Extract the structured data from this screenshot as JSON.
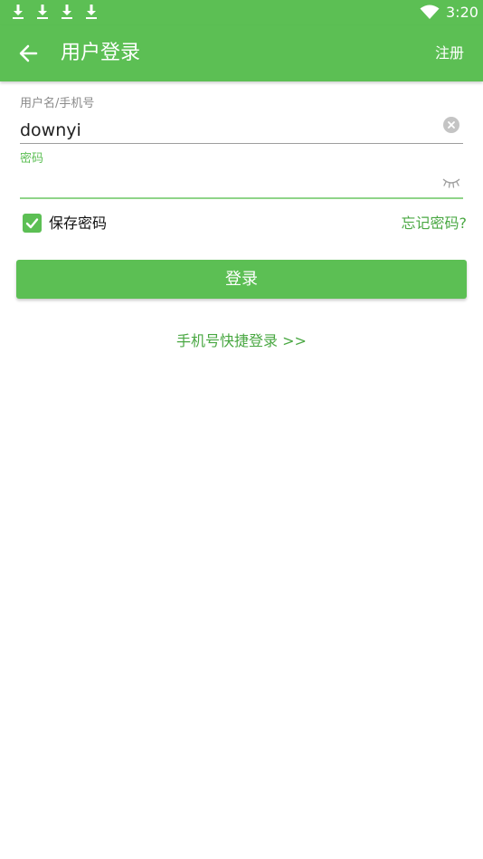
{
  "status_bar": {
    "time": "3:20",
    "notification_icons": [
      "download-icon",
      "download-icon",
      "download-icon",
      "download-icon"
    ],
    "signal_icon": "wifi-icon"
  },
  "app_bar": {
    "back_icon": "arrow-left-icon",
    "title": "用户登录",
    "register_label": "注册"
  },
  "form": {
    "username_label": "用户名/手机号",
    "username_value": "downyi",
    "clear_icon": "clear-circle-icon",
    "password_label": "密码",
    "password_value": "",
    "eye_icon": "eye-closed-icon",
    "save_password_label": "保存密码",
    "save_password_checked": true,
    "forgot_password_label": "忘记密码?",
    "login_button_label": "登录",
    "quick_login_label": "手机号快捷登录 >>"
  },
  "colors": {
    "primary": "#5cbf54",
    "link": "#4aa843",
    "underline_focus": "#8fd489"
  }
}
